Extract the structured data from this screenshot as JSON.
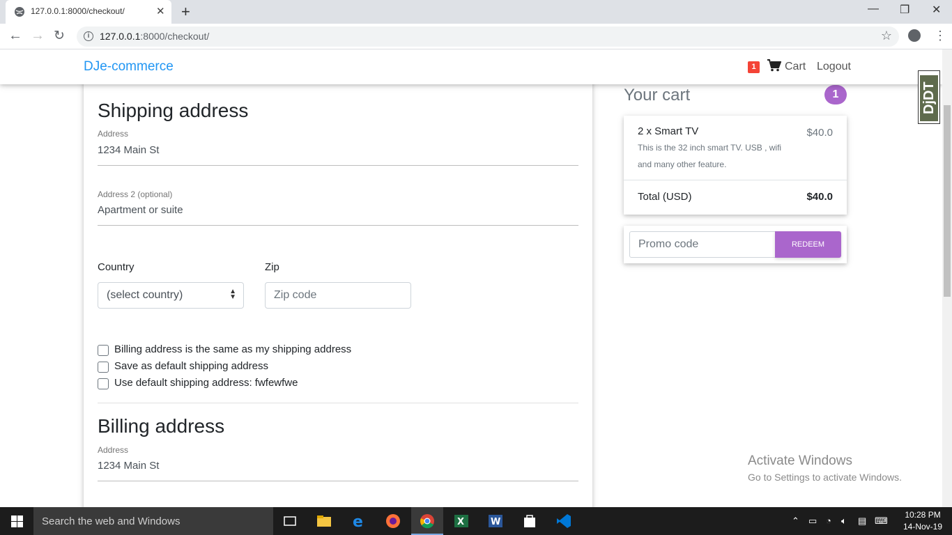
{
  "browser": {
    "tab_title": "127.0.0.1:8000/checkout/",
    "url_host": "127.0.0.1",
    "url_rest": ":8000/checkout/"
  },
  "navbar": {
    "brand": "DJe-commerce",
    "cart_count": "1",
    "cart_label": "Cart",
    "logout_label": "Logout"
  },
  "shipping": {
    "heading": "Shipping address",
    "address_label": "Address",
    "address_placeholder": "1234 Main St",
    "address2_label": "Address 2 (optional)",
    "address2_placeholder": "Apartment or suite",
    "country_label": "Country",
    "country_selected": "(select country)",
    "zip_label": "Zip",
    "zip_placeholder": "Zip code",
    "checks": [
      "Billing address is the same as my shipping address",
      "Save as default shipping address",
      "Use default shipping address: fwfewfwe"
    ]
  },
  "billing": {
    "heading": "Billing address",
    "address_label": "Address",
    "address_placeholder": "1234 Main St"
  },
  "cart": {
    "title": "Your cart",
    "count": "1",
    "item_name": "2 x Smart TV",
    "item_desc": "This is the 32 inch smart TV. USB , wifi and many other feature.",
    "item_price": "$40.0",
    "total_label": "Total (USD)",
    "total_value": "$40.0",
    "promo_placeholder": "Promo code",
    "redeem_label": "REDEEM"
  },
  "djdt": "DjDT",
  "watermark": {
    "title": "Activate Windows",
    "sub": "Go to Settings to activate Windows."
  },
  "taskbar": {
    "search": "Search the web and Windows",
    "time": "10:28 PM",
    "date": "14-Nov-19"
  },
  "colors": {
    "brand": "#2196f3",
    "accent": "#aa66cc",
    "badge": "#f44336"
  }
}
